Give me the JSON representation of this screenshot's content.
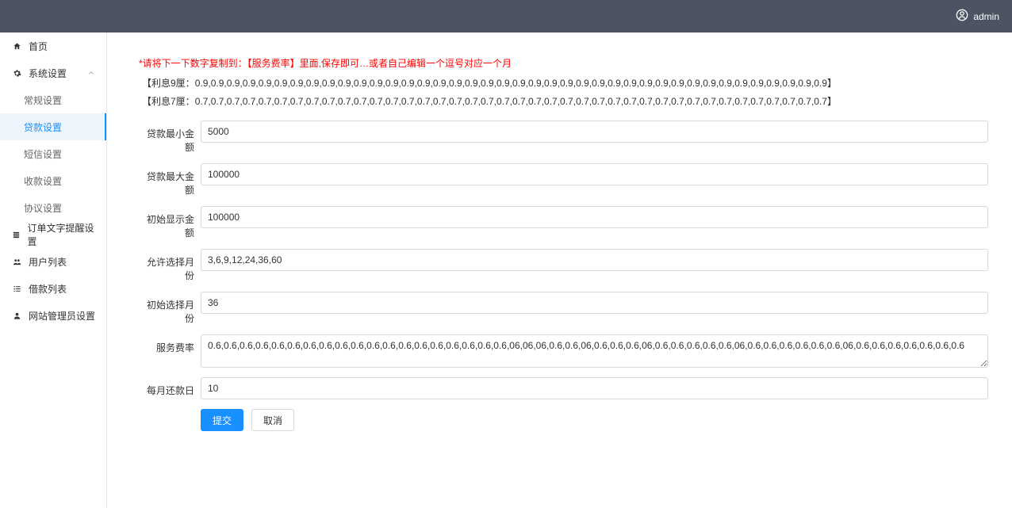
{
  "header": {
    "username": "admin"
  },
  "sidebar": {
    "home": "首页",
    "system_settings": "系统设置",
    "sub": {
      "general": "常规设置",
      "loan": "贷款设置",
      "sms": "短信设置",
      "payment": "收款设置",
      "agreement": "协议设置"
    },
    "order_text": "订单文字提醒设置",
    "user_list": "用户列表",
    "loan_list": "借款列表",
    "admin": "网站管理员设置"
  },
  "notice": {
    "warning": "*请将下一下数字复制到：【服务费率】里面,保存即可…或者自己编辑一个逗号对应一个月",
    "rate9_label": "【利息9厘：",
    "rate9_value": "0.9,0.9,0.9,0.9,0.9,0.9,0.9,0.9,0.9,0.9,0.9,0.9,0.9,0.9,0.9,0.9,0.9,0.9,0.9,0.9,0.9,0.9,0.9,0.9,0.9,0.9,0.9,0.9,0.9,0.9,0.9,0.9,0.9,0.9,0.9,0.9,0.9,0.9,0.9,0.9】",
    "rate7_label": "【利息7厘：",
    "rate7_value": "0.7,0.7,0.7,0.7,0.7,0.7,0.7,0.7,0.7,0.7,0.7,0.7,0.7,0.7,0.7,0.7,0.7,0.7,0.7,0.7,0.7,0.7,0.7,0.7,0.7,0.7,0.7,0.7,0.7,0.7,0.7,0.7,0.7,0.7,0.7,0.7,0.7,0.7,0.7,0.7】"
  },
  "form": {
    "min_amount_label": "贷款最小金额",
    "min_amount_value": "5000",
    "max_amount_label": "贷款最大金额",
    "max_amount_value": "100000",
    "display_amount_label": "初始显示金额",
    "display_amount_value": "100000",
    "months_label": "允许选择月份",
    "months_value": "3,6,9,12,24,36,60",
    "initial_month_label": "初始选择月份",
    "initial_month_value": "36",
    "service_rate_label": "服务费率",
    "service_rate_value": "0.6,0.6,0.6,0.6,0.6,0.6,0.6,0.6,0.6,0.6,0.6,0.6,0.6,0.6,0.6,0.6,0.6,0.6,0.6,06,06,06,0.6,0.6,06,0.6,0.6,0.6,06,0.6,0.6,0.6,0.6,0.6,06,0.6,0.6,0.6,0.6,0.6,0.6,06,0.6,0.6,0.6,0.6,0.6,0.6,0.6",
    "repay_day_label": "每月还款日",
    "repay_day_value": "10",
    "submit": "提交",
    "cancel": "取消"
  }
}
